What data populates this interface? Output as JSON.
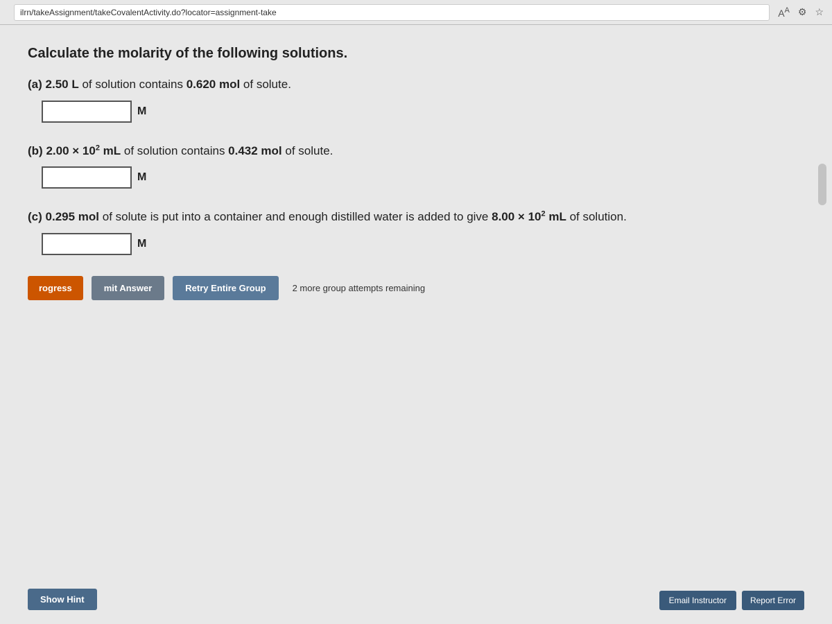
{
  "browser": {
    "url": "ilrn/takeAssignment/takeCovalentActivity.do?locator=assignment-take",
    "icon_font_size": "Aᴬ",
    "icon_settings": "⚙",
    "icon_star": "☆"
  },
  "page": {
    "main_title": "Calculate the molarity of the following solutions.",
    "questions": [
      {
        "id": "a",
        "label_prefix": "(a)",
        "label_text": "2.50 L of solution contains 0.620 mol of solute.",
        "unit": "M",
        "placeholder": ""
      },
      {
        "id": "b",
        "label_prefix": "(b)",
        "label_text_before_super": "2.00 × 10",
        "label_super": "2",
        "label_text_after": " mL of solution contains 0.432 mol of solute.",
        "unit": "M",
        "placeholder": ""
      },
      {
        "id": "c",
        "label_text_before_super1": "0.295 mol of solute is put into a container and enough distilled water is added to give 8.00 × 10",
        "label_super1": "2",
        "label_text_after1": " mL of solution.",
        "label_prefix": "(c)",
        "unit": "M",
        "placeholder": ""
      }
    ],
    "buttons": {
      "progress_label": "rogress",
      "submit_label": "mit Answer",
      "retry_label": "Retry Entire Group",
      "attempts_text": "2 more group attempts remaining",
      "show_hint_label": "Show Hint",
      "email_instructor_label": "Email Instructor",
      "report_label": "Report Error"
    }
  }
}
